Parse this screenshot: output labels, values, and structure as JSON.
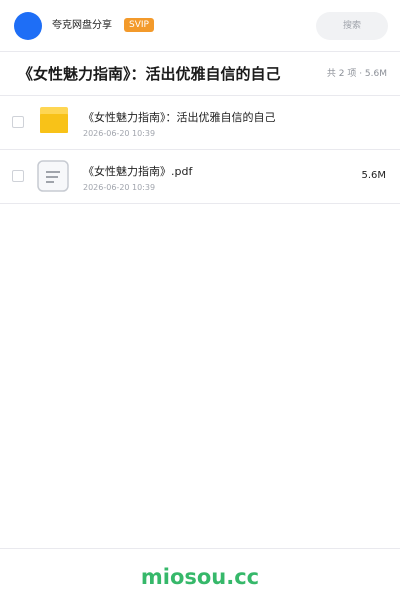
{
  "header": {
    "app_name": "夸克网盘分享",
    "badge": "SVIP",
    "search_placeholder": "搜索",
    "avatar_color": "#1e6ef6",
    "badge_color": "#f39a2b"
  },
  "folder": {
    "title": "《女性魅力指南》：活出优雅自信的自己",
    "summary": "共 2 项 · 5.6M"
  },
  "files": [
    {
      "name": "《女性魅力指南》：活出优雅自信的自己",
      "date": "2026-06-20 10:39",
      "size": "",
      "icon": "folder-icon",
      "icon_color": "#f8c218"
    },
    {
      "name": "《女性魅力指南》.pdf",
      "date": "2026-06-20 10:39",
      "size": "5.6M",
      "icon": "document-icon"
    }
  ],
  "footer": {
    "brand": "miosou.cc",
    "brand_color": "#36b86a"
  }
}
